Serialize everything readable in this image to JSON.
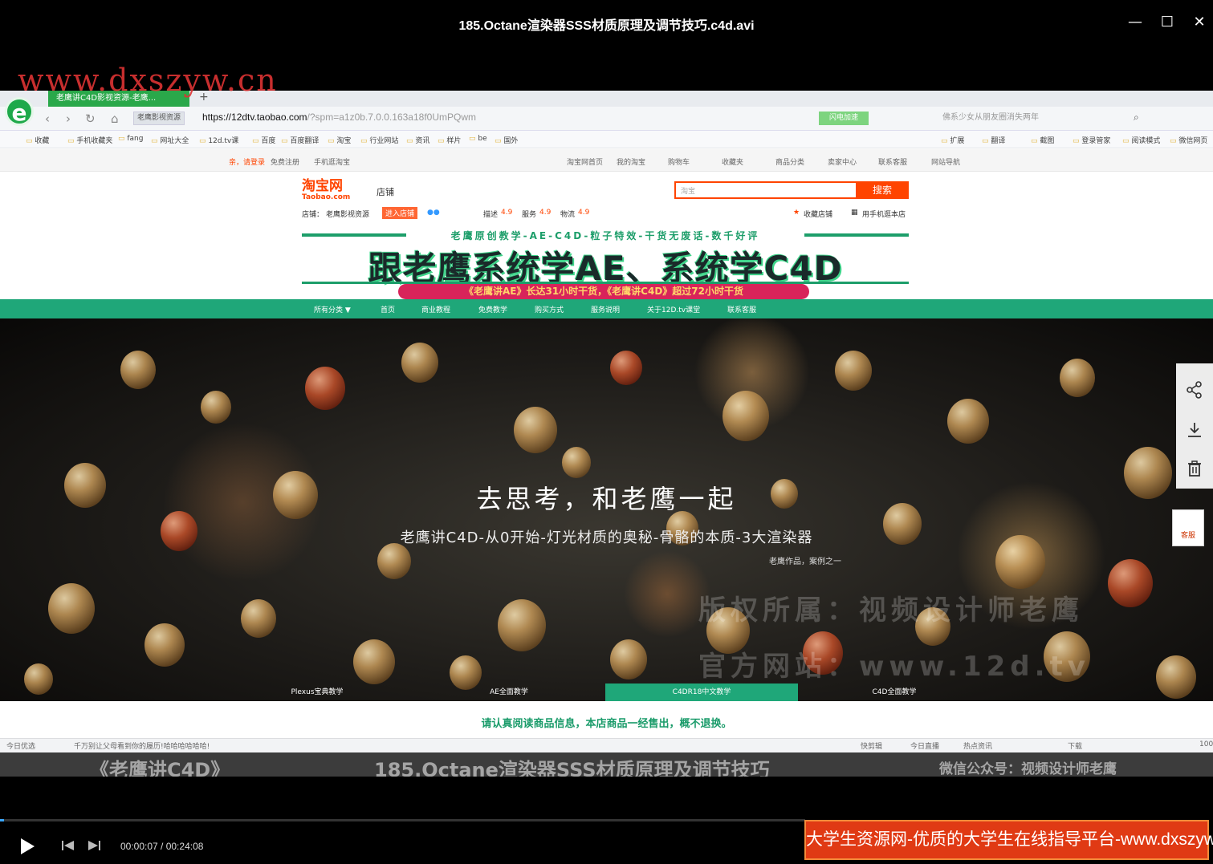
{
  "player": {
    "title": "185.Octane渲染器SSS材质原理及调节技巧.c4d.avi",
    "minimize_glyph": "—",
    "maximize_glyph": "☐",
    "close_glyph": "✕",
    "time_display": "00:00:07 / 00:24:08",
    "progress": 0.005,
    "promo_banner": "大学生资源网-优质的大学生在线指导平台-www.dxszyw.cn"
  },
  "watermark": {
    "url": "www.dxszyw.cn",
    "copyright": "版权所属：视频设计师老鹰",
    "site": "官方网站：www.12d.tv"
  },
  "browser": {
    "tab_title": "老鹰讲C4D影视资源-老鹰...",
    "source_tag": "老鹰影视资源",
    "url_host": "https://12dtv.taobao.com",
    "url_rest": "/?spm=a1z0b.7.0.0.163a18f0UmPQwm",
    "green_button": "闪电加速",
    "search_placeholder": "佛系少女从朋友圈消失两年",
    "bookmarks": [
      "收藏",
      "手机收藏夹",
      "fang",
      "网址大全",
      "12d.tv课",
      "百度",
      "百度翻译",
      "淘宝",
      "行业网站",
      "资讯",
      "样片",
      "be",
      "国外"
    ],
    "bookmark_tools": [
      "扩展",
      "翻译",
      "截图",
      "登录管家",
      "阅读模式",
      "微信网页"
    ],
    "status_left": [
      "今日优选",
      "千万别让父母看到你的履历!哈哈哈哈哈哈!"
    ],
    "status_right": [
      "快剪辑",
      "今日直播",
      "热点资讯",
      "下载",
      "100"
    ]
  },
  "taobao": {
    "top_left": [
      "亲，请登录",
      "免费注册",
      "手机逛淘宝"
    ],
    "top_right": [
      "淘宝网首页",
      "我的淘宝",
      "购物车",
      "收藏夹",
      "商品分类",
      "卖家中心",
      "联系客服",
      "网站导航"
    ],
    "logo": "淘宝网",
    "logo_sub": "Taobao.com",
    "shop_word": "店铺",
    "search_scope": "淘宝",
    "search_button": "搜索",
    "shop_label": "店铺：",
    "shop_name": "老鹰影视资源",
    "enter_shop": "进入店铺",
    "rating_desc": "描述",
    "rating_desc_val": "4.9",
    "rating_service": "服务",
    "rating_service_val": "4.9",
    "rating_logistics": "物流",
    "rating_logistics_val": "4.9",
    "fav_shop": "收藏店铺",
    "mobile_shop": "用手机逛本店"
  },
  "banner": {
    "tagline": "老鹰原创教学-AE-C4D-粒子特效-干货无废话-数千好评",
    "title": "跟老鹰系统学AE、系统学C4D",
    "subtitle": "《老鹰讲AE》长达31小时干货，《老鹰讲C4D》超过72小时干货"
  },
  "shop_menu": [
    "所有分类 ▼",
    "首页",
    "商业教程",
    "免费教学",
    "购买方式",
    "服务说明",
    "关于12D.tv课堂",
    "联系客服"
  ],
  "hero": {
    "heading": "去思考，和老鹰一起",
    "subheading": "老鹰讲C4D-从0开始-灯光材质的奥秘-骨骼的本质-3大渲染器",
    "caption": "老鹰作品，案例之一",
    "tabs": [
      "Plexus宝典教学",
      "AE全面教学",
      "C4DR18中文教学",
      "C4D全面教学"
    ],
    "active_tab": 2
  },
  "side_widgets": {
    "icons": [
      "share-icon",
      "download-icon",
      "trash-icon"
    ],
    "kefu": "客服"
  },
  "notice": "请认真阅读商品信息，本店商品一经售出，概不退换。",
  "video_caption": {
    "left": "《老鹰讲C4D》",
    "center": "185.Octane渲染器SSS材质原理及调节技巧",
    "right": "微信公众号：视频设计师老鹰"
  }
}
